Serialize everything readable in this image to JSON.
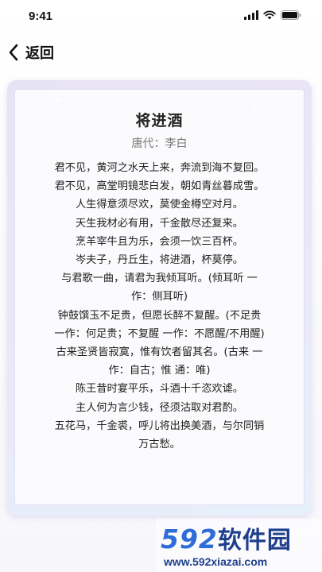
{
  "status_bar": {
    "time": "9:41"
  },
  "nav": {
    "back_label": "返回"
  },
  "poem": {
    "title": "将进酒",
    "author": "唐代：李白",
    "lines": [
      "君不见，黄河之水天上来，奔流到海不复回。",
      "君不见，高堂明镜悲白发，朝如青丝暮成雪。",
      "人生得意须尽欢，莫使金樽空对月。",
      "天生我材必有用，千金散尽还复来。",
      "烹羊宰牛且为乐，会须一饮三百杯。",
      "岑夫子，丹丘生，将进酒，杯莫停。",
      "与君歌一曲，请君为我倾耳听。(倾耳听 一",
      "作：侧耳听)",
      "钟鼓馔玉不足贵，但愿长醉不复醒。(不足贵",
      "一作：何足贵；不复醒 一作：不愿醒/不用醒)",
      "古来圣贤皆寂寞，惟有饮者留其名。(古来 一",
      "作：自古；惟 通：唯)",
      "陈王昔时宴平乐，斗酒十千恣欢谑。",
      "主人何为言少钱，径须沽取对君酌。",
      "五花马，千金裘，呼儿将出换美酒，与尔同销",
      "万古愁。"
    ]
  },
  "watermark": {
    "brand_num": "592",
    "brand_cn": "软件园",
    "url": "www.592xiazai.com"
  },
  "colors": {
    "brand_blue": "#2e6cd8",
    "brand_dark": "#1e3f8c",
    "card_bg": "#e9e5f7"
  }
}
